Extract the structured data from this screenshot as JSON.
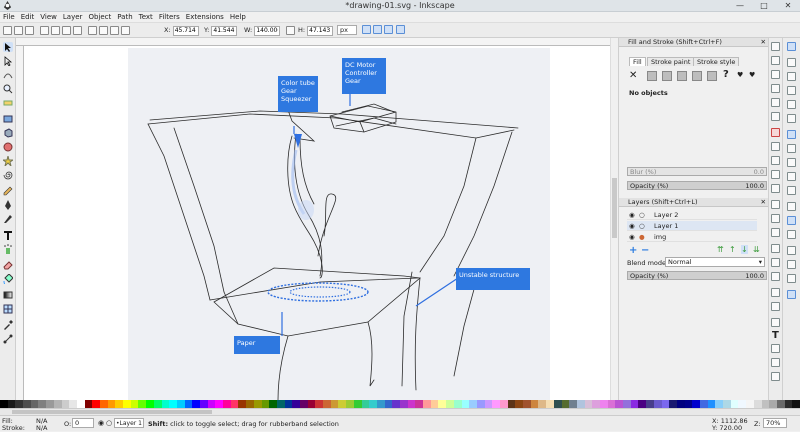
{
  "window": {
    "title": "*drawing-01.svg - Inkscape"
  },
  "menu": [
    "File",
    "Edit",
    "View",
    "Layer",
    "Object",
    "Path",
    "Text",
    "Filters",
    "Extensions",
    "Help"
  ],
  "controls": {
    "x_label": "X:",
    "x_value": "45.714",
    "y_label": "Y:",
    "y_value": "41.544",
    "w_label": "W:",
    "w_value": "140.000",
    "h_label": "H:",
    "h_value": "47.143",
    "unit": "px"
  },
  "annotations": {
    "tube": "Color tube Gear Squeezer",
    "motor": "DC Motor Controller Gear",
    "structure": "Unstable structure",
    "paper": "Paper"
  },
  "fill_stroke": {
    "title": "Fill and Stroke (Shift+Ctrl+F)",
    "tab_fill": "Fill",
    "tab_stroke_paint": "Stroke paint",
    "tab_stroke_style": "Stroke style",
    "no_objects": "No objects",
    "blur_label": "Blur (%)",
    "blur_value": "0.0",
    "opacity_label": "Opacity (%)",
    "opacity_value": "100.0"
  },
  "layers": {
    "title": "Layers (Shift+Ctrl+L)",
    "rows": [
      "Layer 2",
      "Layer 1",
      "img"
    ],
    "blend_label": "Blend mode:",
    "blend_value": "Normal",
    "opacity_label": "Opacity (%)",
    "opacity_value": "100.0"
  },
  "status": {
    "fill_label": "Fill:",
    "fill_value": "N/A",
    "stroke_label": "Stroke:",
    "stroke_value": "N/A",
    "o_label": "O:",
    "o_value": "0",
    "layer": "•Layer 1",
    "message_bold": "Shift:",
    "message": " click to toggle select; drag for rubberband selection",
    "x": "X: 1112.86",
    "y": "Y:  720.00",
    "z_label": "Z:",
    "zoom": "70%"
  },
  "palette_colors": [
    "#000000",
    "#1a1a1a",
    "#333333",
    "#4d4d4d",
    "#666666",
    "#808080",
    "#999999",
    "#b3b3b3",
    "#cccccc",
    "#e6e6e6",
    "#ffffff",
    "#800000",
    "#ff0000",
    "#ff6600",
    "#ff9900",
    "#ffcc00",
    "#ffff00",
    "#ccff00",
    "#66ff00",
    "#00ff00",
    "#00ff66",
    "#00ffcc",
    "#00ffff",
    "#00ccff",
    "#0066ff",
    "#0000ff",
    "#6600ff",
    "#cc00ff",
    "#ff00ff",
    "#ff0099",
    "#ff3366",
    "#993300",
    "#996600",
    "#999900",
    "#669900",
    "#006600",
    "#006666",
    "#003399",
    "#330099",
    "#660066",
    "#990033",
    "#cc3333",
    "#cc6633",
    "#cc9933",
    "#cccc33",
    "#99cc33",
    "#33cc33",
    "#33cc99",
    "#33cccc",
    "#3399cc",
    "#3366cc",
    "#6633cc",
    "#9933cc",
    "#cc33cc",
    "#cc3399",
    "#ff9999",
    "#ffcc99",
    "#ffff99",
    "#ccff99",
    "#99ffcc",
    "#99ffff",
    "#99ccff",
    "#9999ff",
    "#cc99ff",
    "#ff99ff",
    "#ff99cc",
    "#5c3317",
    "#8b4513",
    "#a0522d",
    "#cd853f",
    "#deb887",
    "#f5deb3",
    "#2f4f4f",
    "#556b2f",
    "#708090",
    "#b0c4de",
    "#d8bfd8",
    "#dda0dd",
    "#ee82ee",
    "#da70d6",
    "#ba55d3",
    "#9370db",
    "#8a2be2",
    "#4b0082",
    "#483d8b",
    "#6a5acd",
    "#7b68ee",
    "#191970",
    "#000080",
    "#00008b",
    "#0000cd",
    "#4169e1",
    "#1e90ff",
    "#87cefa",
    "#add8e6",
    "#e0ffff",
    "#f0f8ff",
    "#f5f5f5",
    "#dcdcdc",
    "#c0c0c0",
    "#a9a9a9",
    "#696969",
    "#2b2b2b",
    "#111111"
  ]
}
